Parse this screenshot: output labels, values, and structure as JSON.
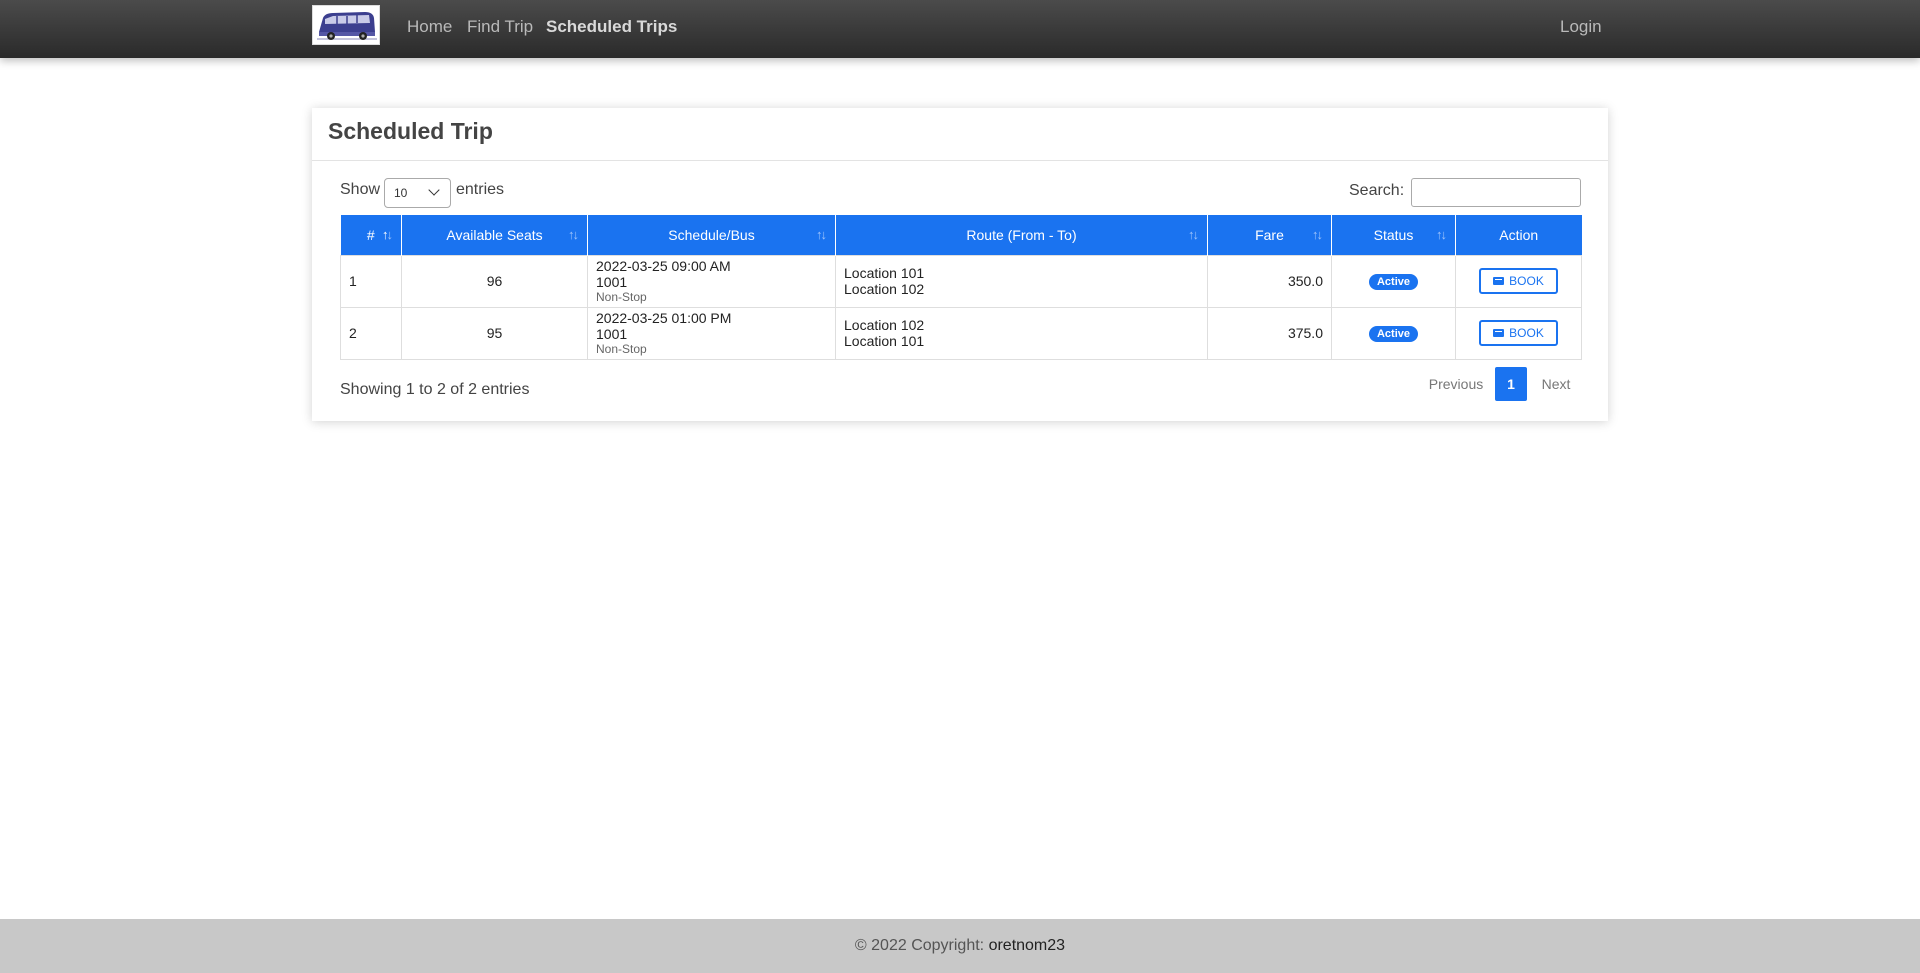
{
  "navbar": {
    "logo_icon": "bus-logo-icon",
    "links": [
      {
        "label": "Home"
      },
      {
        "label": "Find Trip"
      },
      {
        "label": "Scheduled Trips"
      }
    ],
    "login_label": "Login"
  },
  "card": {
    "title": "Scheduled Trip",
    "length": {
      "show_label": "Show",
      "selected": "10",
      "entries_label": "entries"
    },
    "search": {
      "label": "Search:",
      "value": ""
    },
    "table": {
      "headers": [
        "#",
        "Available Seats",
        "Schedule/Bus",
        "Route (From - To)",
        "Fare",
        "Status",
        "Action"
      ],
      "rows": [
        {
          "num": "1",
          "seats": "96",
          "schedule": "2022-03-25 09:00 AM",
          "bus": "1001",
          "type": "Non-Stop",
          "from": "Location 101",
          "to": "Location 102",
          "fare": "350.0",
          "status": "Active",
          "action": "BOOK"
        },
        {
          "num": "2",
          "seats": "95",
          "schedule": "2022-03-25 01:00 PM",
          "bus": "1001",
          "type": "Non-Stop",
          "from": "Location 102",
          "to": "Location 101",
          "fare": "375.0",
          "status": "Active",
          "action": "BOOK"
        }
      ]
    },
    "info": "Showing 1 to 2 of 2 entries",
    "pagination": {
      "previous": "Previous",
      "current": "1",
      "next": "Next"
    }
  },
  "footer": {
    "text": "© 2022 Copyright: ",
    "author": "oretnom23"
  },
  "colors": {
    "accent": "#1a73f0",
    "navbar": "#2a2a2a",
    "footer": "#c8c8c8"
  }
}
